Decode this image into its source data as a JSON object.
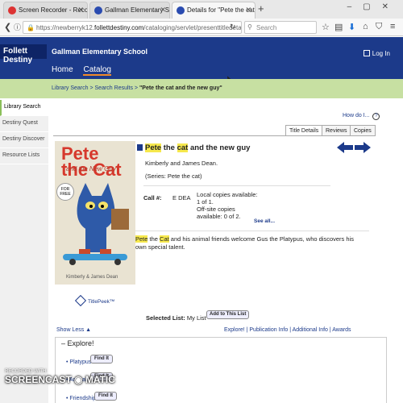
{
  "browser": {
    "tabs": [
      {
        "label": "Screen Recorder - Record yo",
        "icon_color": "#d33"
      },
      {
        "label": "Gallman Elementary School",
        "icon_color": "#2a4bb0"
      },
      {
        "label": "Details for \"Pete the cat and",
        "icon_color": "#2a4bb0"
      }
    ],
    "new_tab": "+",
    "url_scheme": "https://newberryk12.",
    "url_host": "follettdestiny.com",
    "url_path": "/cataloging/servlet/presenttitledetail",
    "search_placeholder": "Search"
  },
  "header": {
    "logo": "Follett Destiny",
    "school": "Gallman Elementary School",
    "login": "Log In",
    "nav": [
      "Home",
      "Catalog"
    ]
  },
  "breadcrumb": {
    "a": "Library Search",
    "sep": " > ",
    "b": "Search Results",
    "current": "\"Pete the cat and the new guy\""
  },
  "sidebar": {
    "items": [
      "Library Search",
      "Destiny Quest",
      "Destiny Discover",
      "Resource Lists"
    ]
  },
  "help": {
    "label": "How do I...",
    "icon": "?"
  },
  "detail_tabs": [
    "Title Details",
    "Reviews",
    "Copies"
  ],
  "book": {
    "title_pre": "Pete",
    "title_mid1": " the ",
    "title_cat": "cat",
    "title_post": " and the new guy",
    "author": "Kimberly and James Dean.",
    "series": "(Series: Pete the cat)",
    "call_label": "Call #:",
    "call_value": "E DEA",
    "avail_1": "Local copies available:",
    "avail_2": "1 of 1.",
    "avail_3": "Off-site copies",
    "avail_4": "available:  0 of 2.",
    "see_all": "See all...",
    "summary_pete": "Pete",
    "summary_the": " the ",
    "summary_cat": "Cat",
    "summary_rest": " and his animal friends welcome Gus the Platypus, who discovers his own special talent.",
    "cover_title1": "Pete",
    "cover_title2": "the Cat",
    "cover_sub": "and the New Guy",
    "cover_badge": "FOR FREE",
    "cover_author": "Kimberly & James Dean"
  },
  "actions": {
    "titlepeek": "TitlePeek™",
    "selected_list_label": "Selected List:",
    "selected_list_value": "My List",
    "add_button": "Add to This List",
    "show_less": "Show Less ▲",
    "links": "Explore! | Publication Info | Additional Info | Awards"
  },
  "explore": {
    "title": "Explore!",
    "subjects": [
      "Platypus",
      "Animals",
      "Friendship"
    ],
    "find_button": "Find It"
  },
  "watermark": {
    "line1": "RECORDED WITH",
    "line2": "SCREENCAST",
    "line3": "MATIC"
  },
  "colors": {
    "header": "#1c3a8a",
    "green_bar": "#c7e0a2",
    "highlight": "#f6e84d"
  }
}
